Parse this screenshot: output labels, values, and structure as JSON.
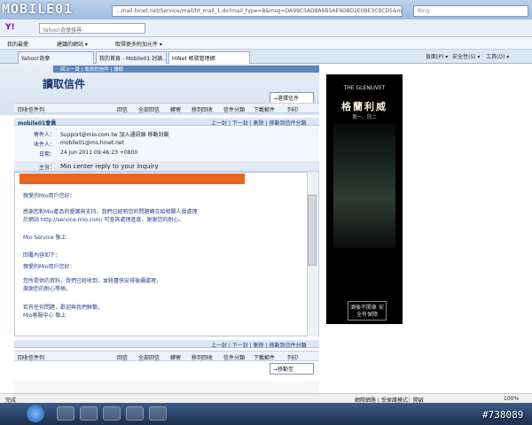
{
  "browser": {
    "logo_text": "MOBILE01",
    "address": "...mail.hinet.net/Service/mail/ht_mail_1.do?mail_type=8&msg=DA99C5AD8A9B5AE9D8D2E0BE3C9CD5&mbid=45&0",
    "search_placeholder": "Bing",
    "yahoo_label": "Y!",
    "yahoo_search_placeholder": "Yahoo!奇摩搜尋",
    "fav_items": [
      "我的最愛",
      "建議的網站 ▾",
      "取得更多附加元件 ▾"
    ],
    "tabs": [
      "Yahoo!奇摩",
      "我的首頁 - Mobile01 討論...",
      "HiNet 帳號管理網"
    ],
    "toolbar_items": [
      "頁面(P) ▾",
      "安全性(S) ▾",
      "工具(O) ▾"
    ]
  },
  "mail": {
    "breadcrumbs": "回上一頁 | 收到的信件 | 讀取",
    "title": "讀取信件",
    "top_select": "→選擇信件",
    "toolbar_left": "回收信件列",
    "toolbar_actions": [
      "回信",
      "全部回信",
      "轉寄",
      "移到回收",
      "信件分類",
      "下載郵件",
      "列印"
    ],
    "pager": "上一封 | 下一封 | 刪除 | 移動到信件分類",
    "sender_bar": "mobile01會員",
    "headers": {
      "from_label": "寄件人：",
      "from_value": "Support@mio.com.tw  加入通訊錄  移動封鎖",
      "to_label": "收件人：",
      "to_value": "mobile01@ms.hinet.net",
      "date_label": "日期：",
      "date_value": "24 Jun 2011 09:46:23 +0800",
      "subject_label": "主旨：",
      "subject_value": "Mio center reply to your inquiry"
    },
    "body_lines": [
      "親愛的Mio用戶您好：",
      "感謝您對Mio產品的愛護與支持，我們已經將您的問題轉交給相關人員處理",
      "於網站 http://service.mio.com/ 可查詢處理進度，謝謝您的耐心。",
      "Mio Service 敬上",
      "回覆內容如下：",
      "親愛的Mio用戶您好：",
      "您所提供的資料，我們已經收到，並將盡快安排後續處理，",
      "謝謝您的耐心等候。",
      "若有任何問題，歡迎與我們聯繫。",
      "Mio客服中心 敬上"
    ],
    "bottom_select": "→移動至"
  },
  "ad": {
    "brand": "THE GLENLIVET",
    "title": "格蘭利威",
    "subtitle": "第一。同二",
    "box_text": "酒後不開車 安全有保障"
  },
  "status": {
    "left": "完成",
    "right": "網際網路 | 受保護模式：開啟",
    "zoom": "100%"
  },
  "taskbar": {
    "watermark": "#738089"
  },
  "colors": {
    "accent": "#1d3b73",
    "ad_bg": "#000000",
    "orange": "#e8661e"
  }
}
